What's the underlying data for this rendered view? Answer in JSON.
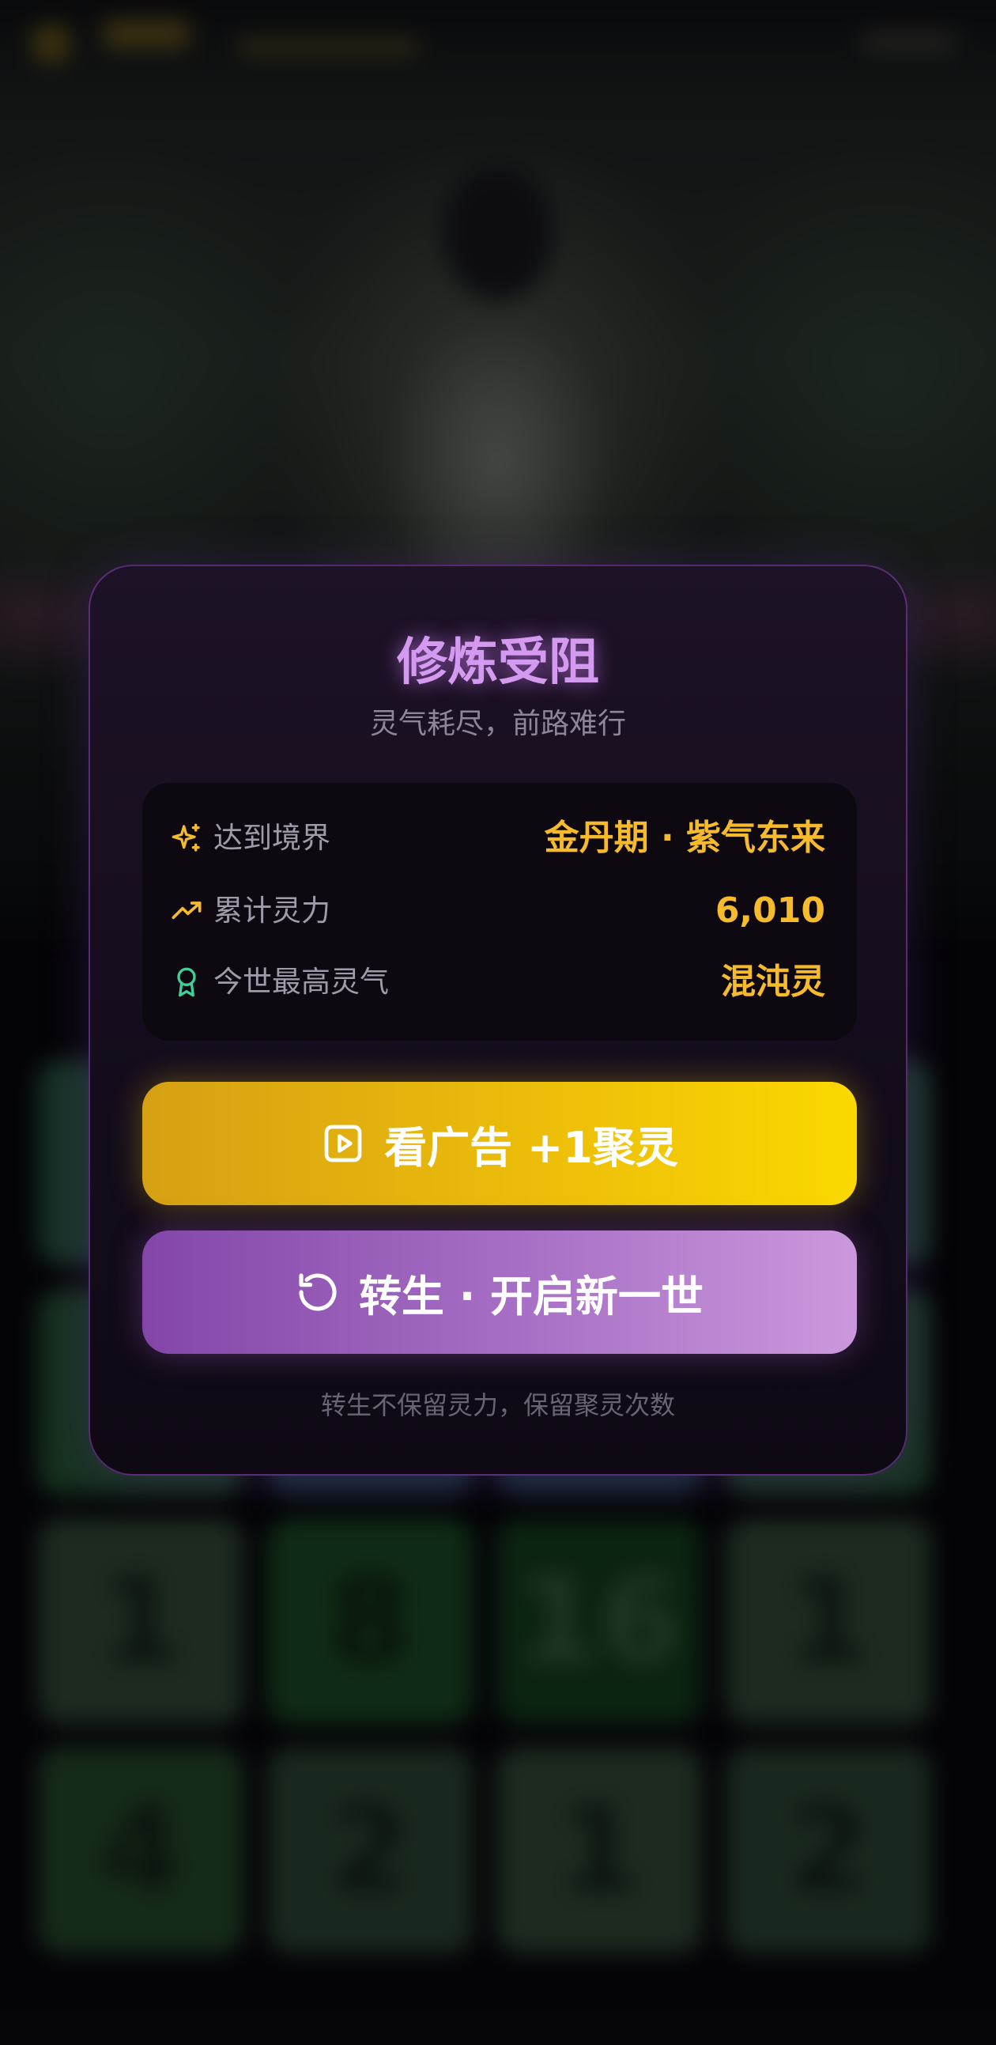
{
  "modal": {
    "title": "修炼受阻",
    "subtitle": "灵气耗尽，前路难行",
    "stats": [
      {
        "icon": "sparkles-icon",
        "label": "达到境界",
        "value": "金丹期 · 紫气东来",
        "icon_color": "#f5bb2c"
      },
      {
        "icon": "trending-up-icon",
        "label": "累计灵力",
        "value": "6,010",
        "icon_color": "#f5bb2c"
      },
      {
        "icon": "award-icon",
        "label": "今世最高灵气",
        "value": "混沌灵",
        "icon_color": "#3fcf9a"
      }
    ],
    "ad_button": {
      "icon": "play-video-icon",
      "label": "看广告 +1聚灵"
    },
    "rebirth_button": {
      "icon": "rotate-ccw-icon",
      "label": "转生 · 开启新一世"
    },
    "footnote": "转生不保留灵力，保留聚灵次数"
  },
  "background_board": {
    "tiles": [
      "",
      "",
      "",
      "",
      "",
      "",
      "",
      "",
      "1",
      "8",
      "16",
      "1",
      "4",
      "2",
      "1",
      "2"
    ]
  },
  "colors": {
    "title": "#d39af0",
    "value": "#f5bb2c",
    "ad_button": "#ecbd0a",
    "rebirth_button": "#a871c6"
  }
}
